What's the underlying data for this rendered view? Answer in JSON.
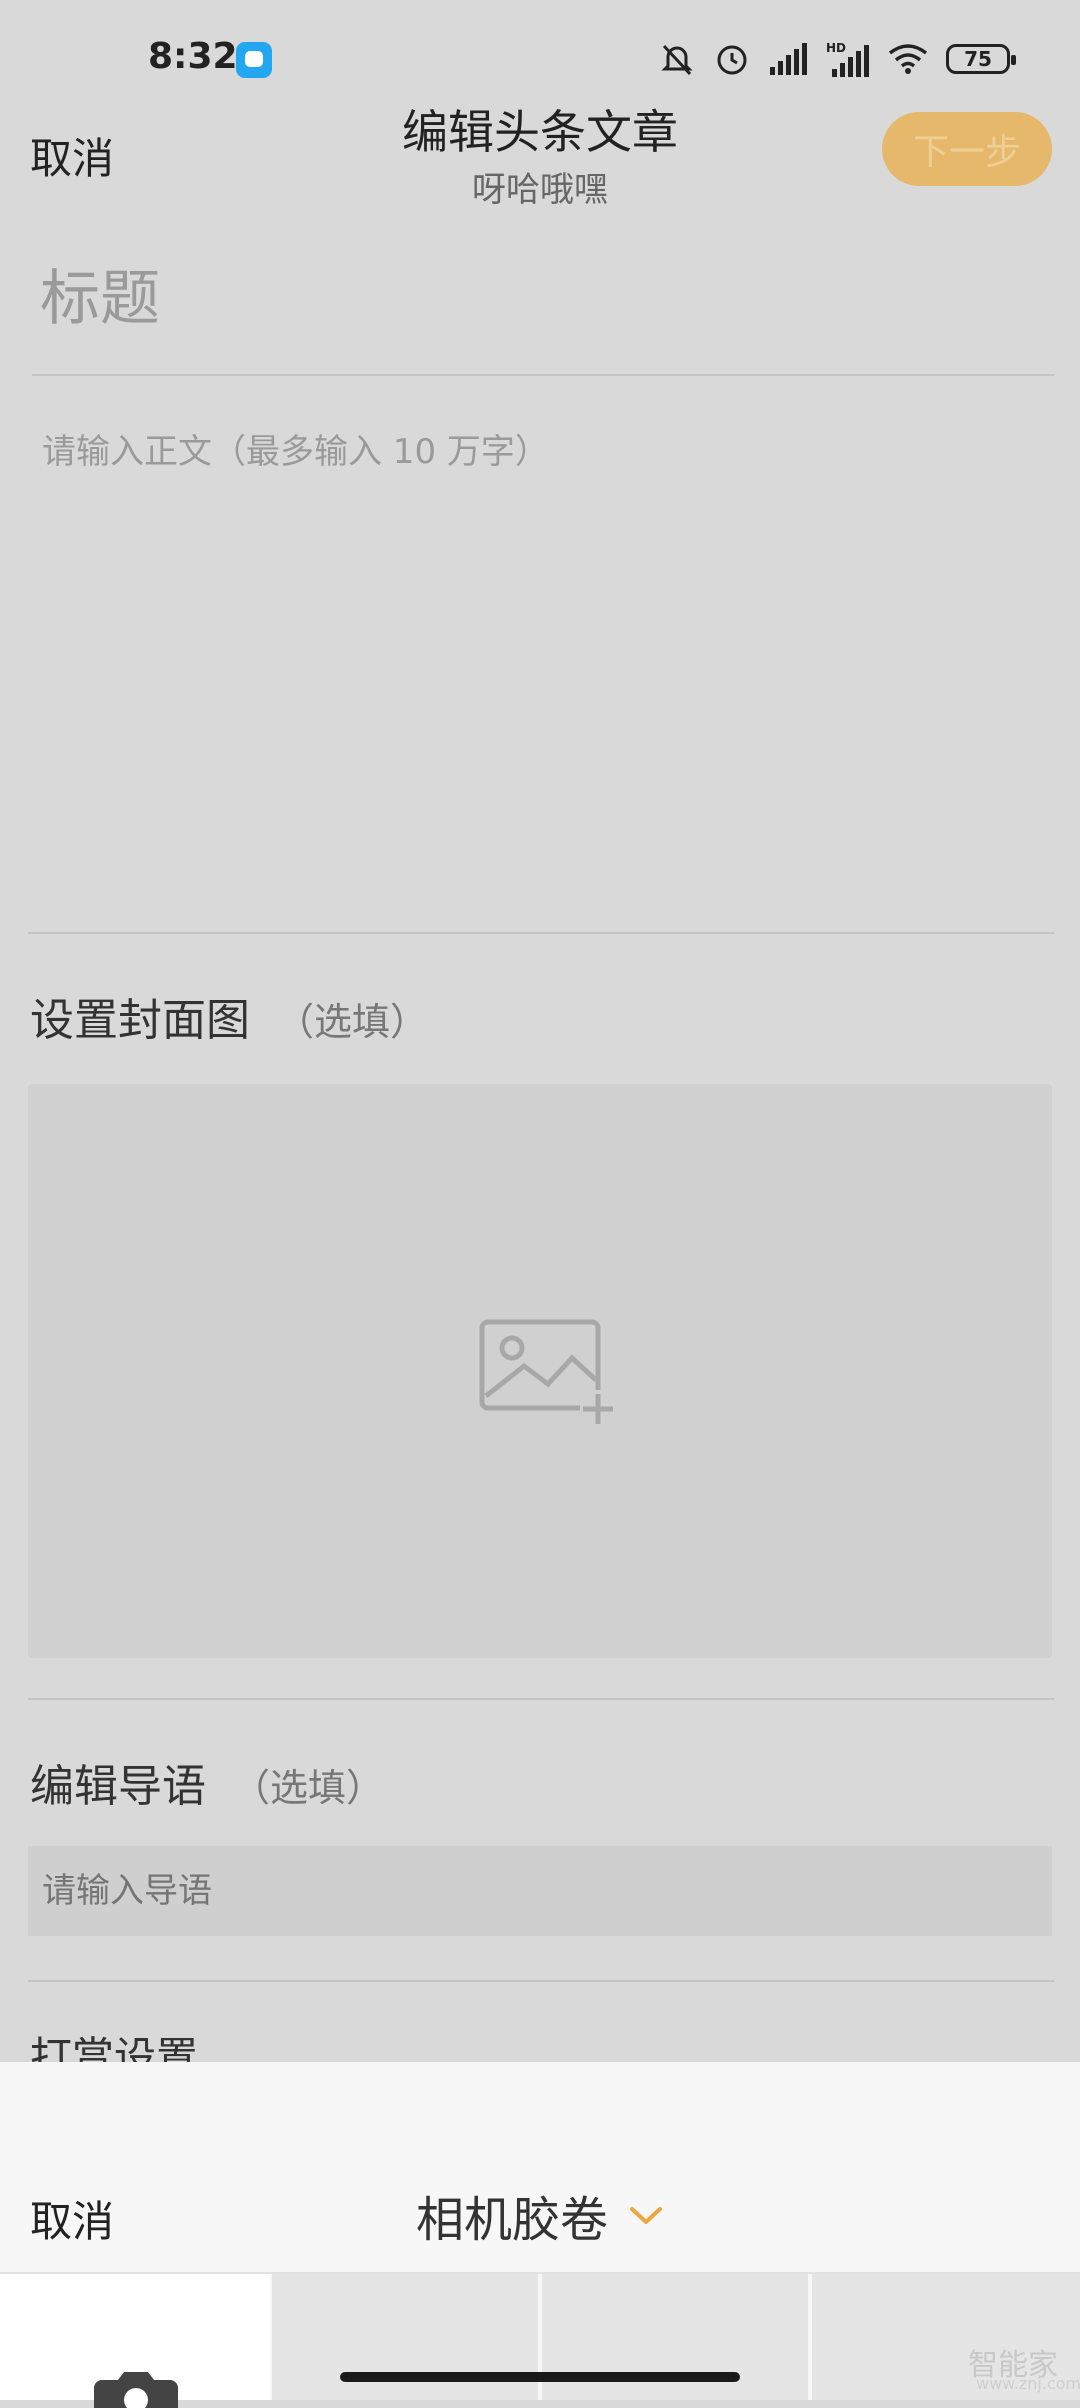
{
  "status_bar": {
    "time": "8:32",
    "battery": "75",
    "icons": [
      "app-badge-icon",
      "mute-icon",
      "alarm-icon",
      "signal-icon",
      "hd-signal-icon",
      "wifi-icon",
      "battery-icon"
    ]
  },
  "header": {
    "cancel": "取消",
    "title": "编辑头条文章",
    "subtitle": "呀哈哦嘿",
    "next": "下一步"
  },
  "editor": {
    "title_placeholder": "标题",
    "body_placeholder": "请输入正文（最多输入 10 万字）"
  },
  "cover": {
    "label": "设置封面图",
    "optional": "（选填）",
    "icon": "add-image-icon"
  },
  "lead": {
    "label": "编辑导语",
    "optional": "（选填）",
    "placeholder": "请输入导语"
  },
  "reward": {
    "label": "打赏设置"
  },
  "picker": {
    "cancel": "取消",
    "album": "相机胶卷",
    "chevron_icon": "chevron-down-icon",
    "camera_icon": "camera-icon"
  },
  "watermark": {
    "text": "智能家",
    "url": "www.znj.com"
  },
  "colors": {
    "accent": "#f0a640",
    "next_button": "#e5b86b",
    "overlay_bg": "#d9d9d9"
  }
}
